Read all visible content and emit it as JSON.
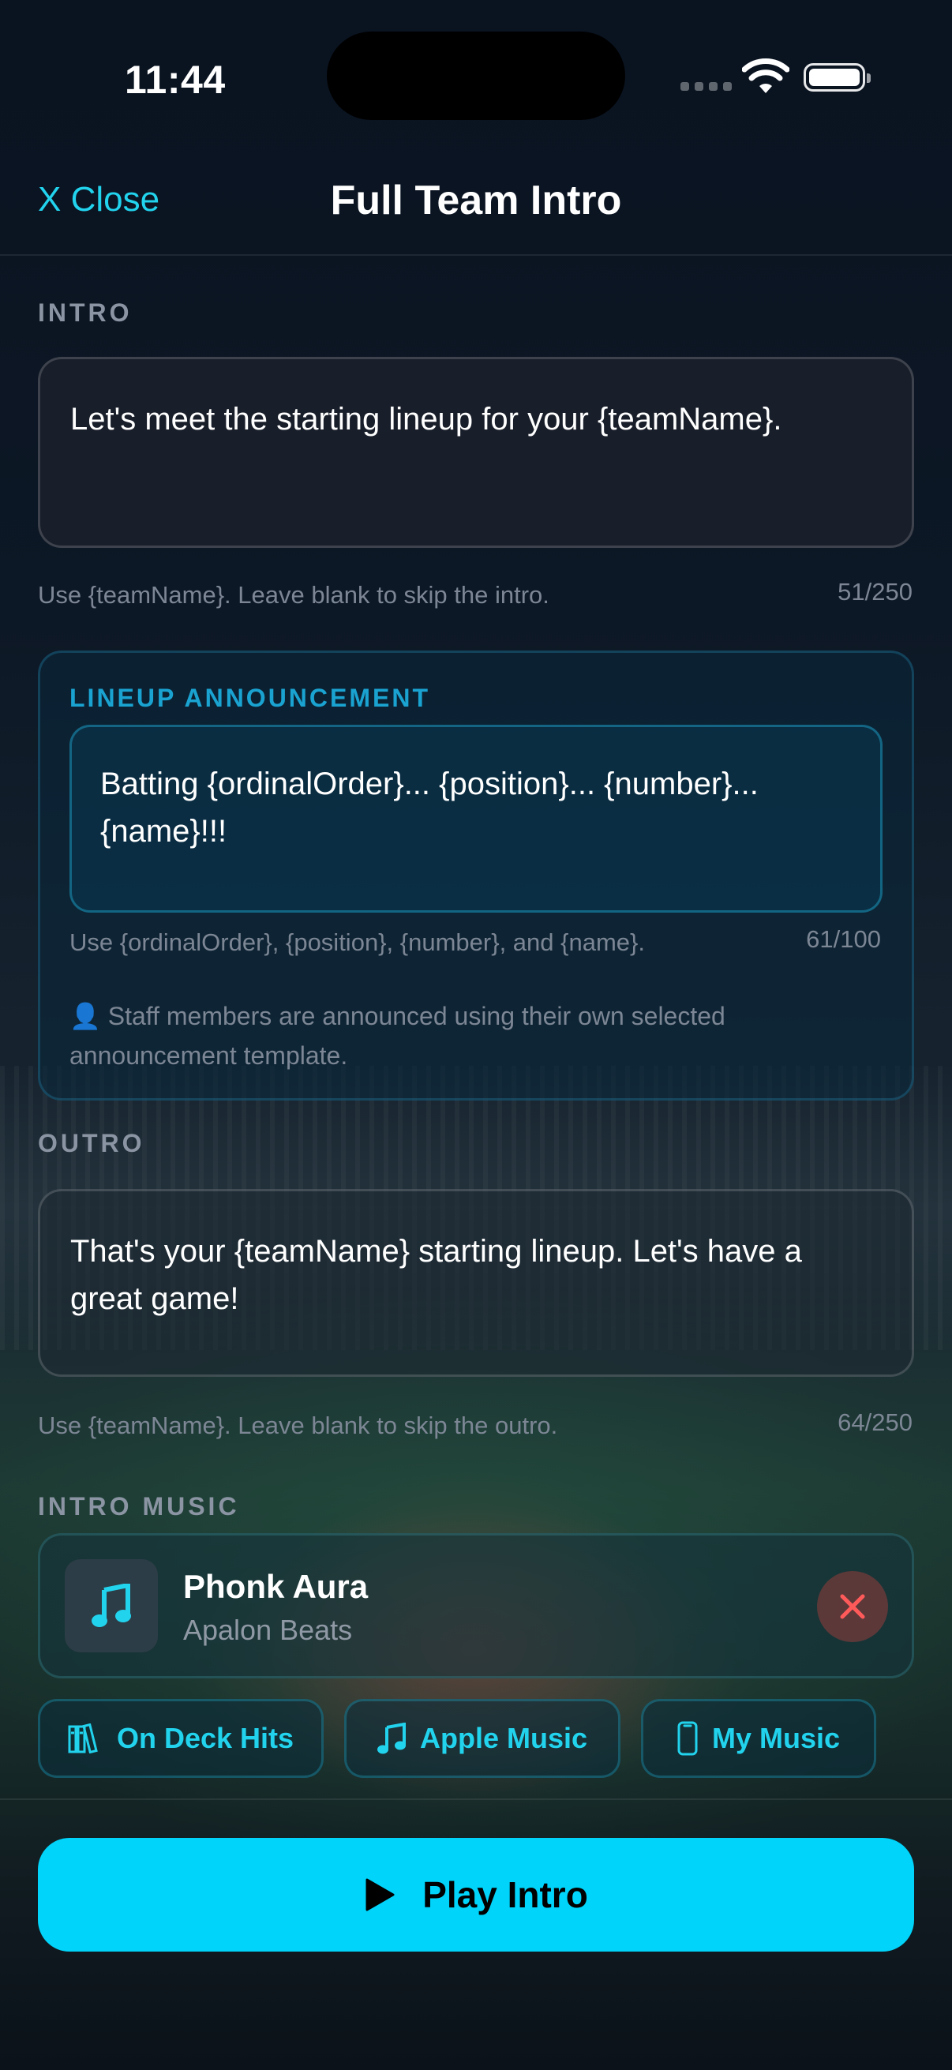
{
  "status_bar": {
    "time": "11:44"
  },
  "nav": {
    "close_label": "X Close",
    "title": "Full Team Intro"
  },
  "intro": {
    "label": "INTRO",
    "value": "Let's meet the starting lineup for your {teamName}.",
    "helper": "Use {teamName}. Leave blank to skip the intro.",
    "counter": "51/250"
  },
  "lineup": {
    "label": "LINEUP ANNOUNCEMENT",
    "value": "Batting {ordinalOrder}... {position}... {number}... {name}!!!",
    "helper": "Use {ordinalOrder}, {position}, {number}, and {name}.",
    "counter": "61/100",
    "staff_note": "👤 Staff members are announced using their own selected announcement template."
  },
  "outro": {
    "label": "OUTRO",
    "value": "That's your {teamName} starting lineup. Let's have a great game!",
    "helper": "Use {teamName}. Leave blank to skip the outro.",
    "counter": "64/250"
  },
  "music": {
    "label": "INTRO MUSIC",
    "track_title": "Phonk Aura",
    "artist": "Apalon Beats",
    "sources": [
      {
        "label": "On Deck Hits",
        "icon": "library-icon"
      },
      {
        "label": "Apple Music",
        "icon": "music-note-icon"
      },
      {
        "label": "My Music",
        "icon": "phone-icon"
      }
    ]
  },
  "play_button": {
    "label": "Play Intro"
  },
  "colors": {
    "accent": "#22d3ee",
    "play_button": "#00d4fa",
    "remove": "#ff5a5a"
  }
}
